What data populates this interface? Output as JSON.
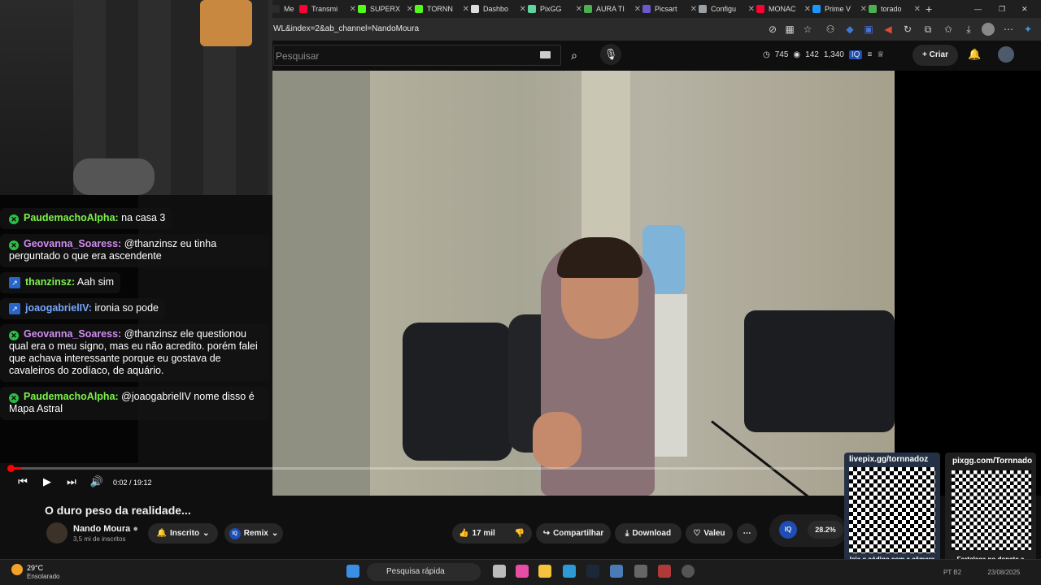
{
  "browser": {
    "tabs": [
      {
        "label": "Me",
        "color": "#2b2b2b"
      },
      {
        "label": "Transmi",
        "color": "#ff0033"
      },
      {
        "label": "SUPERX",
        "color": "#53fc18"
      },
      {
        "label": "TORNN",
        "color": "#53fc18"
      },
      {
        "label": "Dashbo",
        "color": "#dddddd"
      },
      {
        "label": "PixGG",
        "color": "#5fd3a0"
      },
      {
        "label": "AURA TI",
        "color": "#4caf50"
      },
      {
        "label": "Picsart",
        "color": "#6a5acd"
      },
      {
        "label": "Configu",
        "color": "#9aa0a6"
      },
      {
        "label": "MONAC",
        "color": "#ff0033"
      },
      {
        "label": "Prime V",
        "color": "#1a98ff"
      },
      {
        "label": "torado",
        "color": "#4caf50"
      }
    ],
    "new_tab": "+",
    "url": "WL&index=2&ab_channel=NandoMoura"
  },
  "youtube": {
    "search_placeholder": "Pesquisar",
    "stats": {
      "a": "745",
      "b": "142",
      "c": "1,340"
    },
    "create_label": "Criar"
  },
  "chat": [
    {
      "user": "",
      "text": "",
      "partial": true
    },
    {
      "user": "PaudemachoAlpha:",
      "text": "na casa 3",
      "badge": "x",
      "color": "#7cf24a"
    },
    {
      "user": "Geovanna_Soaress:",
      "text": "@thanzinsz eu tinha perguntado o que era ascendente",
      "badge": "x",
      "color": "#d18cf2"
    },
    {
      "user": "thanzinsz:",
      "text": "Aah sim",
      "badge": "sq",
      "color": "#7cf24a"
    },
    {
      "user": "joaogabrielIV:",
      "text": "ironia so pode",
      "badge": "sq",
      "color": "#76a8ff"
    },
    {
      "user": "Geovanna_Soaress:",
      "text": "@thanzinsz ele questionou qual era o meu signo, mas eu não acredito. porém falei que achava interessante porque eu gostava de cavaleiros do zodíaco, de aquário.",
      "badge": "x",
      "color": "#d18cf2"
    },
    {
      "user": "PaudemachoAlpha:",
      "text": "@joaogabrielIV nome disso é Mapa Astral",
      "badge": "x",
      "color": "#7cf24a"
    }
  ],
  "player": {
    "time": "0:02 / 19:12",
    "progress": 0.002
  },
  "video": {
    "title": "O duro peso da realidade...",
    "channel": "Nando Moura",
    "subscribers": "3,5 mi de inscritos",
    "subscribe_label": "Inscrito",
    "remix_label": "Remix",
    "likes": "17 mil",
    "share_label": "Compartilhar",
    "download_label": "Download",
    "thanks_label": "Valeu",
    "iq_percent": "28.2%",
    "iq_logo": "IQ"
  },
  "overlays": {
    "left_title": "livepix.gg/tornnadoz",
    "left_caption": "leia o código com a câmera do celular.",
    "right_title": "pixgg.com/Tornnado",
    "right_caption": "Fortaleça no donate e envie sua mensagem!"
  },
  "taskbar": {
    "temperature": "29°C",
    "condition": "Ensolarado",
    "search_label": "Pesquisa rápida",
    "tray_text": "PT B2",
    "date": "23/08/2025"
  }
}
